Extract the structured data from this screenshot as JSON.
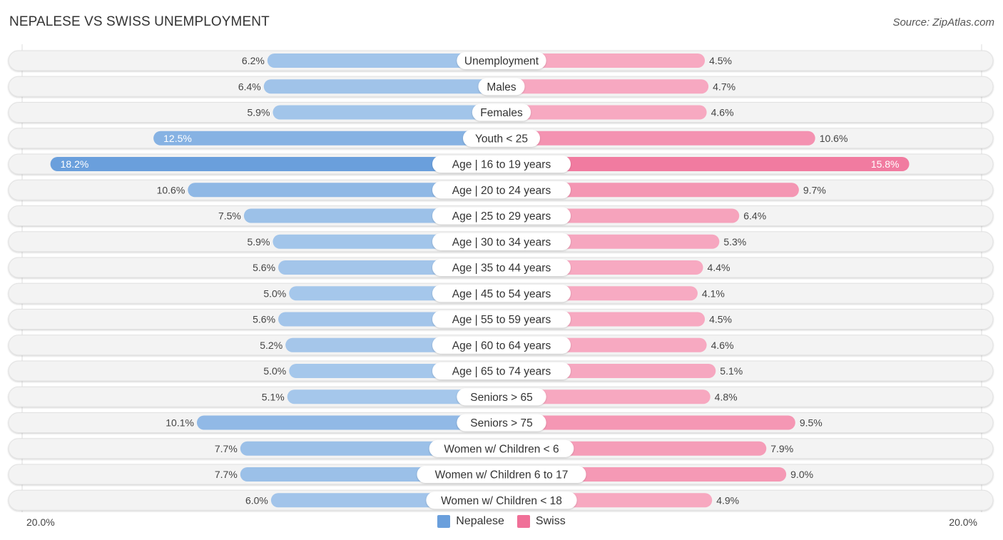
{
  "title": "NEPALESE VS SWISS UNEMPLOYMENT",
  "source": "Source: ZipAtlas.com",
  "axis": {
    "left_label": "20.0%",
    "right_label": "20.0%"
  },
  "legend": [
    {
      "name": "Nepalese",
      "color": "#6a9fdc"
    },
    {
      "name": "Swiss",
      "color": "#f07098"
    }
  ],
  "chart_data": {
    "type": "bar",
    "orientation": "horizontal-diverging",
    "title": "NEPALESE VS SWISS UNEMPLOYMENT",
    "xlabel": "",
    "ylabel": "",
    "xlim": [
      -20,
      20
    ],
    "tick_labels": [
      "20.0%",
      "20.0%"
    ],
    "legend_position": "bottom-center",
    "categories": [
      "Unemployment",
      "Males",
      "Females",
      "Youth < 25",
      "Age | 16 to 19 years",
      "Age | 20 to 24 years",
      "Age | 25 to 29 years",
      "Age | 30 to 34 years",
      "Age | 35 to 44 years",
      "Age | 45 to 54 years",
      "Age | 55 to 59 years",
      "Age | 60 to 64 years",
      "Age | 65 to 74 years",
      "Seniors > 65",
      "Seniors > 75",
      "Women w/ Children < 6",
      "Women w/ Children 6 to 17",
      "Women w/ Children < 18"
    ],
    "series": [
      {
        "name": "Nepalese",
        "side": "left",
        "color": "#6a9fdc",
        "values": [
          6.2,
          6.4,
          5.9,
          12.5,
          18.2,
          10.6,
          7.5,
          5.9,
          5.6,
          5.0,
          5.6,
          5.2,
          5.0,
          5.1,
          10.1,
          7.7,
          7.7,
          6.0
        ]
      },
      {
        "name": "Swiss",
        "side": "right",
        "color": "#f07098",
        "values": [
          4.5,
          4.7,
          4.6,
          10.6,
          15.8,
          9.7,
          6.4,
          5.3,
          4.4,
          4.1,
          4.5,
          4.6,
          5.1,
          4.8,
          9.5,
          7.9,
          9.0,
          4.9
        ]
      }
    ],
    "value_format": "{v}%"
  }
}
